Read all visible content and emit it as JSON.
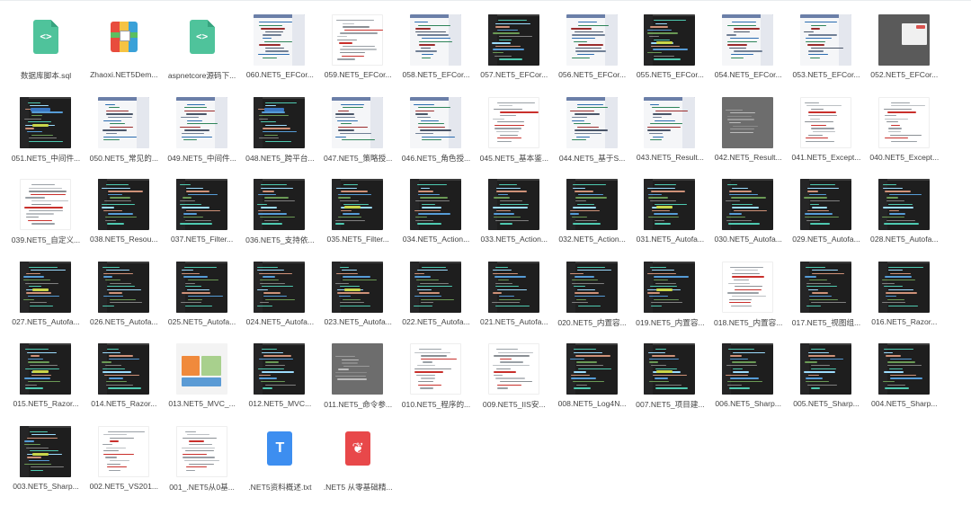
{
  "files": [
    {
      "name": "数据库脚本.sql",
      "kind": "code"
    },
    {
      "name": "Zhaoxi.NET5Dem...",
      "kind": "zip"
    },
    {
      "name": "aspnetcore源码下...",
      "kind": "code"
    },
    {
      "name": "060.NET5_EFCor...",
      "kind": "light"
    },
    {
      "name": "059.NET5_EFCor...",
      "kind": "doc"
    },
    {
      "name": "058.NET5_EFCor...",
      "kind": "light"
    },
    {
      "name": "057.NET5_EFCor...",
      "kind": "dark"
    },
    {
      "name": "056.NET5_EFCor...",
      "kind": "light"
    },
    {
      "name": "055.NET5_EFCor...",
      "kind": "dark"
    },
    {
      "name": "054.NET5_EFCor...",
      "kind": "light"
    },
    {
      "name": "053.NET5_EFCor...",
      "kind": "light"
    },
    {
      "name": "052.NET5_EFCor...",
      "kind": "graydialog"
    },
    {
      "name": "051.NET5_中间件...",
      "kind": "darkblue"
    },
    {
      "name": "050.NET5_常见的...",
      "kind": "light"
    },
    {
      "name": "049.NET5_中间件...",
      "kind": "light"
    },
    {
      "name": "048.NET5_跨平台...",
      "kind": "darkblue"
    },
    {
      "name": "047.NET5_策略授...",
      "kind": "light"
    },
    {
      "name": "046.NET5_角色授...",
      "kind": "light"
    },
    {
      "name": "045.NET5_基本鉴...",
      "kind": "doc"
    },
    {
      "name": "044.NET5_基于S...",
      "kind": "light"
    },
    {
      "name": "043.NET5_Result...",
      "kind": "light"
    },
    {
      "name": "042.NET5_Result...",
      "kind": "gray"
    },
    {
      "name": "041.NET5_Except...",
      "kind": "doc"
    },
    {
      "name": "040.NET5_Except...",
      "kind": "doc"
    },
    {
      "name": "039.NET5_自定义...",
      "kind": "doc"
    },
    {
      "name": "038.NET5_Resou...",
      "kind": "dark"
    },
    {
      "name": "037.NET5_Filter...",
      "kind": "dark"
    },
    {
      "name": "036.NET5_支持依...",
      "kind": "dark"
    },
    {
      "name": "035.NET5_Filter...",
      "kind": "dark"
    },
    {
      "name": "034.NET5_Action...",
      "kind": "dark"
    },
    {
      "name": "033.NET5_Action...",
      "kind": "dark"
    },
    {
      "name": "032.NET5_Action...",
      "kind": "dark"
    },
    {
      "name": "031.NET5_Autofa...",
      "kind": "dark"
    },
    {
      "name": "030.NET5_Autofa...",
      "kind": "dark"
    },
    {
      "name": "029.NET5_Autofa...",
      "kind": "dark"
    },
    {
      "name": "028.NET5_Autofa...",
      "kind": "dark"
    },
    {
      "name": "027.NET5_Autofa...",
      "kind": "dark"
    },
    {
      "name": "026.NET5_Autofa...",
      "kind": "dark"
    },
    {
      "name": "025.NET5_Autofa...",
      "kind": "dark"
    },
    {
      "name": "024.NET5_Autofa...",
      "kind": "dark"
    },
    {
      "name": "023.NET5_Autofa...",
      "kind": "dark"
    },
    {
      "name": "022.NET5_Autofa...",
      "kind": "dark"
    },
    {
      "name": "021.NET5_Autofa...",
      "kind": "dark"
    },
    {
      "name": "020.NET5_内置容...",
      "kind": "dark"
    },
    {
      "name": "019.NET5_内置容...",
      "kind": "dark"
    },
    {
      "name": "018.NET5_内置容...",
      "kind": "doc"
    },
    {
      "name": "017.NET5_视图组...",
      "kind": "dark"
    },
    {
      "name": "016.NET5_Razor...",
      "kind": "dark"
    },
    {
      "name": "015.NET5_Razor...",
      "kind": "dark"
    },
    {
      "name": "014.NET5_Razor...",
      "kind": "dark"
    },
    {
      "name": "013.NET5_MVC_...",
      "kind": "colorful"
    },
    {
      "name": "012.NET5_MVC...",
      "kind": "dark"
    },
    {
      "name": "011.NET5_命令参...",
      "kind": "gray"
    },
    {
      "name": "010.NET5_程序的...",
      "kind": "doc"
    },
    {
      "name": "009.NET5_IIS安...",
      "kind": "doc"
    },
    {
      "name": "008.NET5_Log4N...",
      "kind": "dark"
    },
    {
      "name": "007.NET5_项目建...",
      "kind": "dark"
    },
    {
      "name": "006.NET5_Sharp...",
      "kind": "dark"
    },
    {
      "name": "005.NET5_Sharp...",
      "kind": "dark"
    },
    {
      "name": "004.NET5_Sharp...",
      "kind": "dark"
    },
    {
      "name": "003.NET5_Sharp...",
      "kind": "dark"
    },
    {
      "name": "002.NET5_VS201...",
      "kind": "doc"
    },
    {
      "name": "001_.NET5从0基...",
      "kind": "doc"
    },
    {
      "name": ".NET5资料概述.txt",
      "kind": "txt"
    },
    {
      "name": ".NET5 从零基础精...",
      "kind": "pdf"
    }
  ],
  "icon_colors": {
    "code": "#4fc39b",
    "txt": "#3d8ef0",
    "pdf": "#e8484a"
  }
}
